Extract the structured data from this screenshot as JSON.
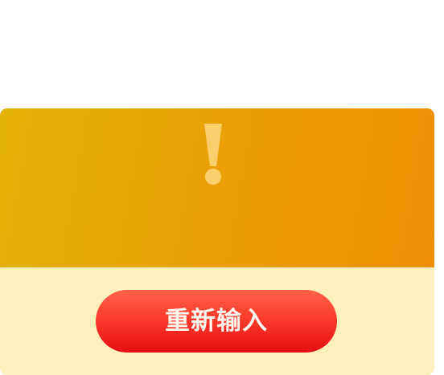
{
  "dialog": {
    "icon": "exclamation-icon",
    "button_label": "重新输入"
  },
  "colors": {
    "header_gradient_start": "#e3b106",
    "header_gradient_end": "#ef8e04",
    "icon_color": "#fbd06c",
    "footer_background": "#fdf0bd",
    "button_top": "#ff6149",
    "button_bottom": "#e60d14",
    "button_text": "#fff8ef"
  }
}
